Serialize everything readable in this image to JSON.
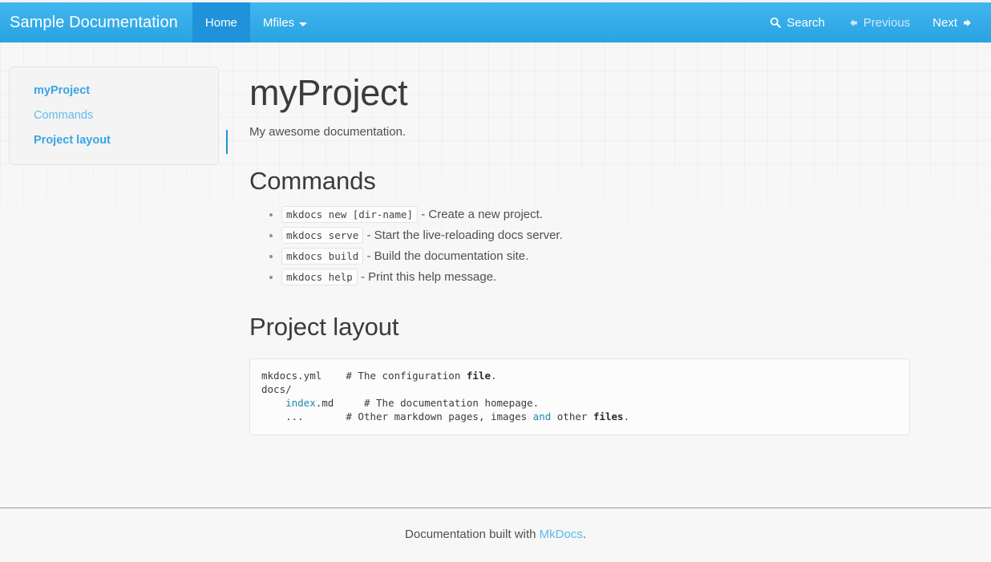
{
  "navbar": {
    "brand": "Sample Documentation",
    "items": [
      {
        "label": "Home",
        "active": true
      },
      {
        "label": "Mfiles",
        "active": false,
        "has_caret": true
      }
    ],
    "search_label": "Search",
    "previous_label": "Previous",
    "next_label": "Next",
    "accent_bg": "#2aa3e2",
    "active_bg": "#1f92da",
    "disabled_color": "#cfe9f9"
  },
  "sidebar": {
    "items": [
      {
        "label": "myProject",
        "level": 1,
        "active": false
      },
      {
        "label": "Commands",
        "level": 2,
        "active": false
      },
      {
        "label": "Project layout",
        "level": 1,
        "active": true
      }
    ],
    "active_indicator_color": "#1f92da"
  },
  "main": {
    "title": "myProject",
    "lead": "My awesome documentation.",
    "commands_heading": "Commands",
    "commands": [
      {
        "code": "mkdocs new [dir-name]",
        "description": " - Create a new project."
      },
      {
        "code": "mkdocs serve",
        "description": " - Start the live-reloading docs server."
      },
      {
        "code": "mkdocs build",
        "description": " - Build the documentation site."
      },
      {
        "code": "mkdocs help",
        "description": " - Print this help message."
      }
    ],
    "layout_heading": "Project layout",
    "layout_code": {
      "line1_path": "mkdocs.yml",
      "line1_gap": "    ",
      "line1_comment_a": "# The configuration ",
      "line1_bold": "file",
      "line1_comment_b": ".",
      "line2_path": "docs/",
      "line3_indent": "    ",
      "line3_name": "index",
      "line3_ext": ".md",
      "line3_gap": "     ",
      "line3_comment": "# The documentation homepage.",
      "line4_indent": "    ",
      "line4_dots": "...",
      "line4_gap": "       ",
      "line4_comment_a": "# Other markdown pages, images ",
      "line4_kw": "and",
      "line4_comment_b": " other ",
      "line4_bold": "files",
      "line4_comment_c": "."
    }
  },
  "footer": {
    "text_before": "Documentation built with ",
    "link_label": "MkDocs",
    "text_after": "."
  }
}
